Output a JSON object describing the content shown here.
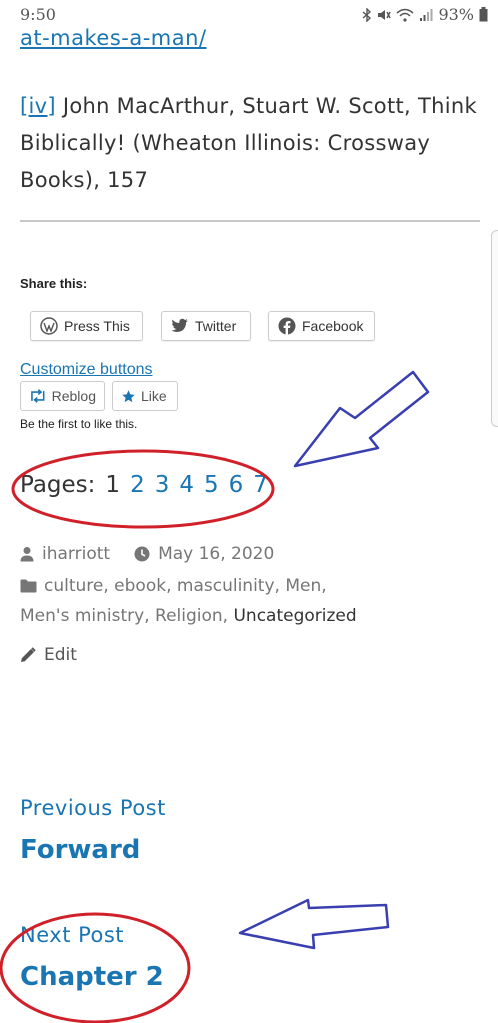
{
  "status_bar": {
    "time": "9:50",
    "battery": "93%"
  },
  "article": {
    "url_tail": "at-makes-a-man/",
    "footnote_ref": "[iv]",
    "footnote_text": " John MacArthur, Stuart W. Scott, Think Biblically! (Wheaton Illinois: Crossway Books), 157"
  },
  "share": {
    "heading": "Share this:",
    "buttons": [
      {
        "label": "Press This",
        "icon": "wordpress-icon"
      },
      {
        "label": "Twitter",
        "icon": "twitter-icon"
      },
      {
        "label": "Facebook",
        "icon": "facebook-icon"
      }
    ],
    "customize": "Customize buttons",
    "reblog": "Reblog",
    "like": "Like",
    "first_like": "Be the first to like this."
  },
  "pagination": {
    "label": "Pages:",
    "current": "1",
    "pages": [
      "2",
      "3",
      "4",
      "5",
      "6",
      "7"
    ]
  },
  "meta": {
    "author": "iharriott",
    "date": "May 16, 2020",
    "categories": [
      "culture",
      "ebook",
      "masculinity",
      "Men",
      "Men's ministry",
      "Religion",
      "Uncategorized"
    ],
    "edit": "Edit"
  },
  "post_nav": {
    "previous_label": "Previous Post",
    "previous_title": "Forward",
    "next_label": "Next Post",
    "next_title": "Chapter 2"
  },
  "colors": {
    "link": "#1a75b3",
    "annotation_circle": "#d0202a",
    "annotation_arrow": "#3a3fb0"
  }
}
